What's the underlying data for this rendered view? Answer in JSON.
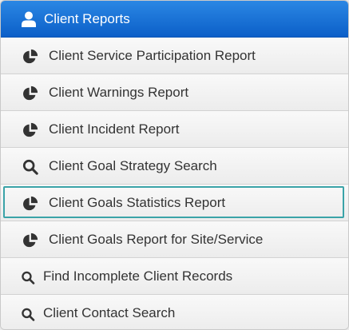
{
  "header": {
    "title": "Client Reports",
    "icon": "user-icon",
    "color": "#1a74db"
  },
  "items": [
    {
      "label": "Client Service Participation Report",
      "icon": "pie-chart-icon"
    },
    {
      "label": "Client Warnings Report",
      "icon": "pie-chart-icon"
    },
    {
      "label": "Client Incident Report",
      "icon": "pie-chart-icon"
    },
    {
      "label": "Client Goal Strategy Search",
      "icon": "search-icon"
    },
    {
      "label": "Client Goals Statistics Report",
      "icon": "pie-chart-icon",
      "focused": true
    },
    {
      "label": "Client Goals Report for Site/Service",
      "icon": "pie-chart-icon"
    },
    {
      "label": "Find Incomplete Client Records",
      "icon": "search-icon"
    },
    {
      "label": "Client Contact Search",
      "icon": "search-icon"
    }
  ],
  "colors": {
    "focus_outline": "#3aa3a8",
    "item_text": "#333333"
  }
}
